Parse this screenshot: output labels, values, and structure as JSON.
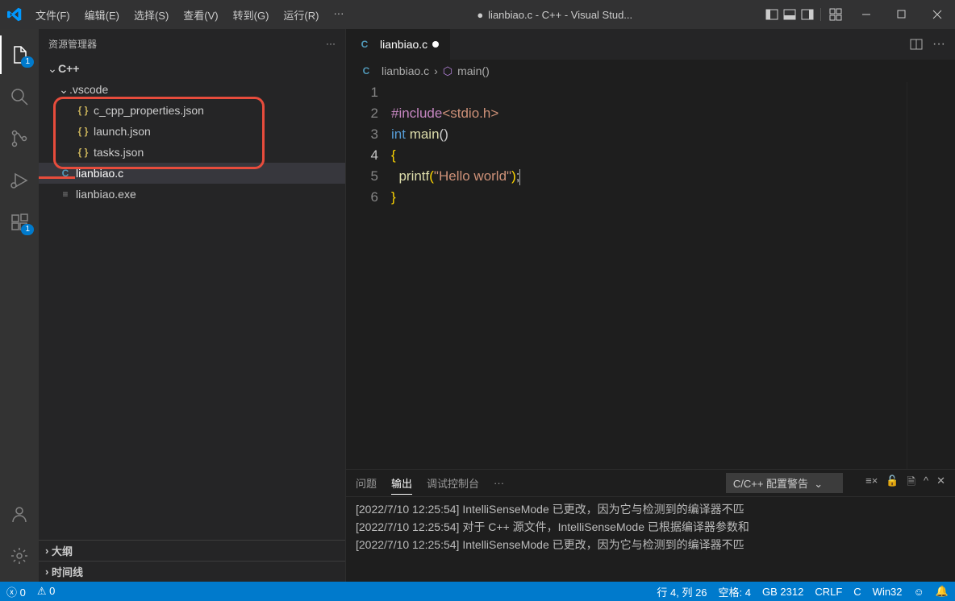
{
  "title": {
    "dirty": "●",
    "text": "lianbiao.c - C++ - Visual Stud..."
  },
  "menu": {
    "file": "文件(F)",
    "edit": "编辑(E)",
    "select": "选择(S)",
    "view": "查看(V)",
    "goto": "转到(G)",
    "run": "运行(R)",
    "more": "···"
  },
  "explorer": {
    "title": "资源管理器",
    "root": "C++",
    "vscode": ".vscode",
    "files": {
      "ccpp": "c_cpp_properties.json",
      "launch": "launch.json",
      "tasks": "tasks.json",
      "lianbiao": "lianbiao.c",
      "exe": "lianbiao.exe"
    },
    "outline": "大纲",
    "timeline": "时间线"
  },
  "tab": {
    "icon": "C",
    "name": "lianbiao.c"
  },
  "breadcrumb": {
    "file": "lianbiao.c",
    "sym": "main()"
  },
  "code": {
    "ln": [
      "1",
      "2",
      "3",
      "4",
      "5",
      "6"
    ],
    "include": "#include",
    "stdio": "<stdio.h>",
    "int": "int ",
    "main": "main",
    "paren": "()",
    "lb": "{",
    "rb": "}",
    "printf": "printf",
    "op": "(",
    "str": "\"Hello world\"",
    "cp": ")",
    ";": ";"
  },
  "panel": {
    "problems": "问题",
    "output": "输出",
    "debug": "调试控制台",
    "more": "···",
    "select": "C/C++ 配置警告",
    "lines": [
      "[2022/7/10 12:25:54] IntelliSenseMode 已更改，因为它与检测到的编译器不匹",
      "[2022/7/10 12:25:54] 对于 C++ 源文件，IntelliSenseMode 已根据编译器参数和",
      "[2022/7/10 12:25:54] IntelliSenseMode 已更改，因为它与检测到的编译器不匹"
    ]
  },
  "status": {
    "err": "0",
    "warn": "0",
    "pos": "行 4, 列 26",
    "spaces": "空格: 4",
    "enc": "GB 2312",
    "eol": "CRLF",
    "lang": "C",
    "target": "Win32"
  },
  "badges": {
    "explorer": "1",
    "ext": "1"
  }
}
